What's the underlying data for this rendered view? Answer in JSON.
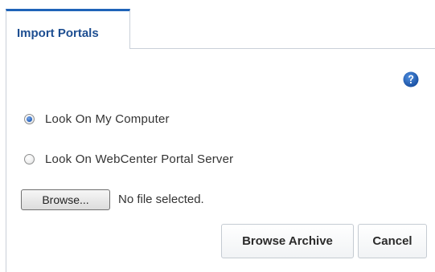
{
  "tabs": [
    {
      "label": "Import Portals",
      "selected": true
    }
  ],
  "help": {
    "icon": "help-icon",
    "color": "#1f5cb6"
  },
  "source_options": [
    {
      "label": "Look On My Computer",
      "checked": true
    },
    {
      "label": "Look On WebCenter Portal Server",
      "checked": false
    }
  ],
  "file_picker": {
    "browse_label": "Browse...",
    "status_text": "No file selected."
  },
  "actions": {
    "browse_archive_label": "Browse Archive",
    "cancel_label": "Cancel"
  },
  "colors": {
    "tab_accent": "#1f63b8",
    "tab_text": "#1d4e91",
    "border": "#c9d0d8"
  }
}
